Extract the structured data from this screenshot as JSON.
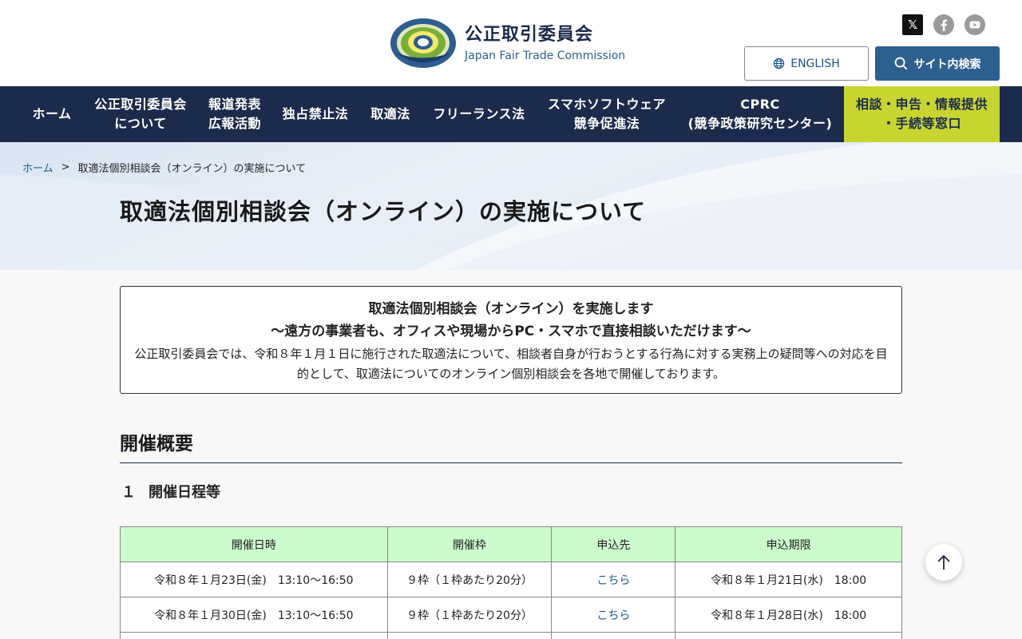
{
  "header": {
    "logo_jp": "公正取引委員会",
    "logo_en": "Japan Fair Trade Commission",
    "logo_ring_text": "JAPAN FAIR TRADE COMMISSION",
    "english_label": "ENGLISH",
    "search_label": "サイト内検索",
    "social": [
      "x-icon",
      "facebook-icon",
      "youtube-icon"
    ]
  },
  "nav": {
    "items": [
      {
        "line1": "ホーム",
        "line2": ""
      },
      {
        "line1": "公正取引委員会",
        "line2": "について"
      },
      {
        "line1": "報道発表",
        "line2": "広報活動"
      },
      {
        "line1": "独占禁止法",
        "line2": ""
      },
      {
        "line1": "取適法",
        "line2": ""
      },
      {
        "line1": "フリーランス法",
        "line2": ""
      },
      {
        "line1": "スマホソフトウェア",
        "line2": "競争促進法"
      },
      {
        "line1": "CPRC",
        "line2": "(競争政策研究センター)"
      },
      {
        "line1": "相談・申告・情報提供",
        "line2": "・手続等窓口"
      }
    ]
  },
  "breadcrumb": {
    "home": "ホーム",
    "separator": ">",
    "current": "取適法個別相談会（オンライン）の実施について"
  },
  "page_title": "取適法個別相談会（オンライン）の実施について",
  "notice": {
    "title1": "取適法個別相談会（オンライン）を実施します",
    "title2": "〜遠方の事業者も、オフィスや現場からPC・スマホで直接相談いただけます〜",
    "body": "公正取引委員会では、令和８年１月１日に施行された取適法について、相談者自身が行おうとする行為に対する実務上の疑問等への対応を目的として、取適法についてのオンライン個別相談会を各地で開催しております。"
  },
  "section": {
    "h2": "開催概要",
    "h3_num": "１",
    "h3_label": "開催日程等"
  },
  "table": {
    "headers": [
      "開催日時",
      "開催枠",
      "申込先",
      "申込期限"
    ],
    "rows": [
      [
        "令和８年１月23日(金)　13:10〜16:50",
        "９枠（１枠あたり20分）",
        "こちら",
        "令和８年１月21日(水)　18:00"
      ],
      [
        "令和８年１月30日(金)　13:10〜16:50",
        "９枠（１枠あたり20分）",
        "こちら",
        "令和８年１月28日(水)　18:00"
      ],
      [
        "",
        "",
        "",
        ""
      ]
    ]
  },
  "colors": {
    "nav_bg": "#1c2b4b",
    "consult_bg": "#c8d530",
    "search_bg": "#2d5f8f",
    "table_header_bg": "#ccfcce",
    "link": "#1d5a9e"
  }
}
